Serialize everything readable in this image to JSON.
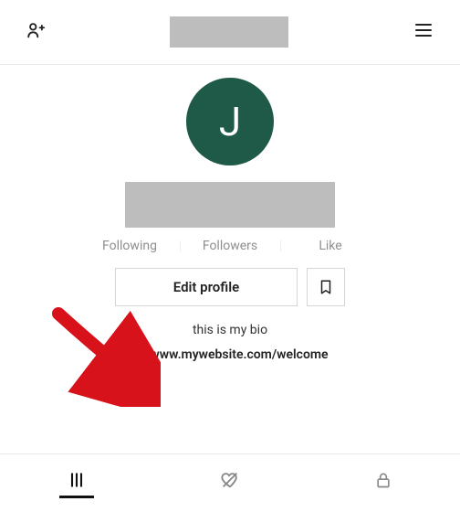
{
  "header": {
    "title_redacted": true
  },
  "profile": {
    "avatar_initial": "J",
    "username_redacted": true,
    "stats": {
      "following": "Following",
      "followers": "Followers",
      "like": "Like"
    },
    "edit_button": "Edit profile",
    "bio": "this is my bio",
    "link": "www.mywebsite.com/welcome"
  },
  "tabs": {
    "active": "feed"
  }
}
